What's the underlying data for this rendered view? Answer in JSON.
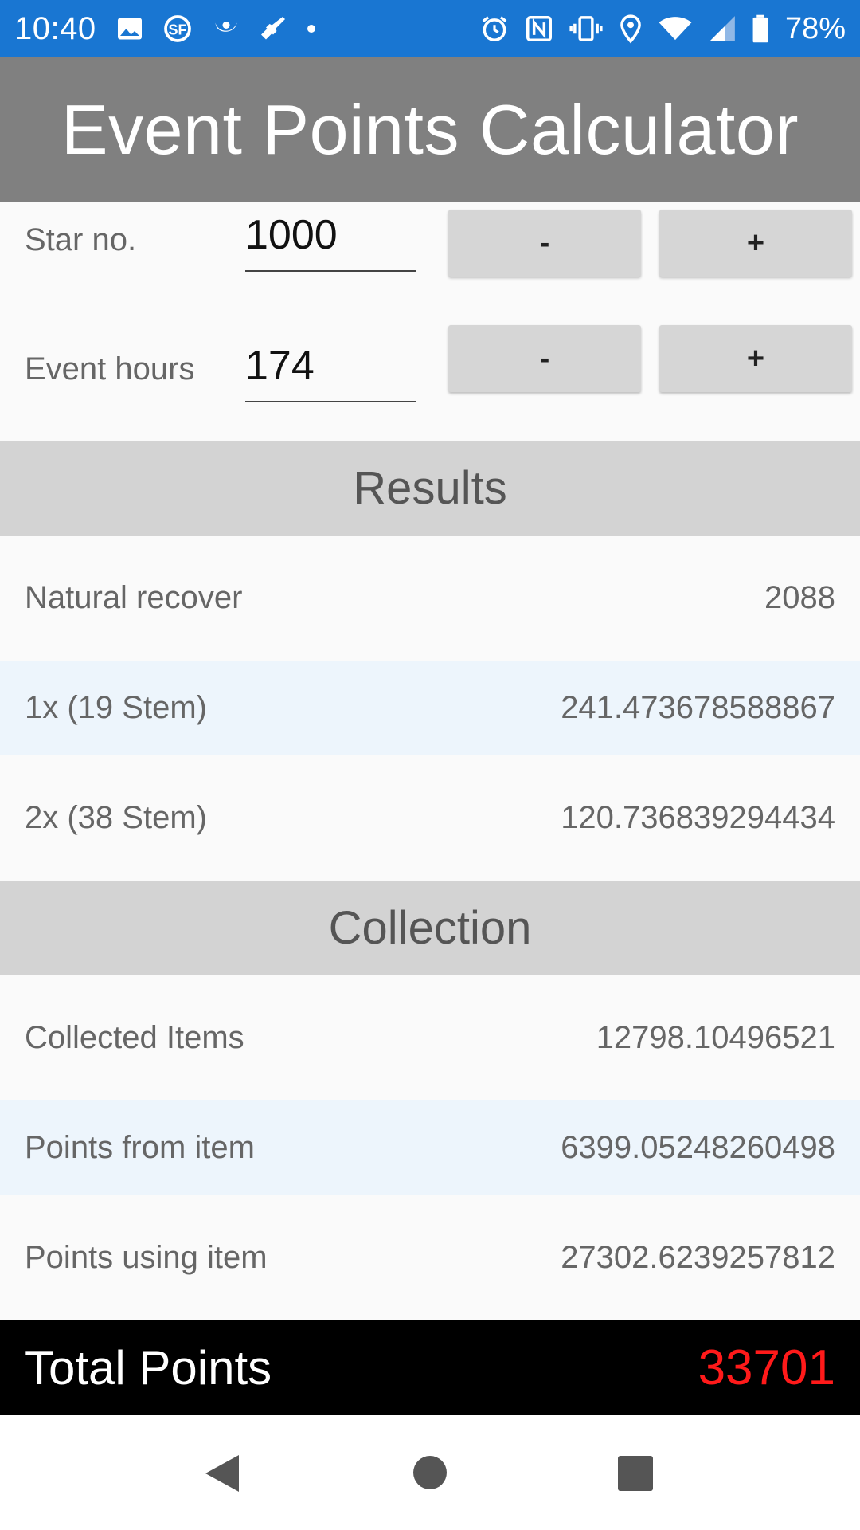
{
  "status_bar": {
    "time": "10:40",
    "battery": "78%",
    "left_icons": [
      "image-icon",
      "sf-app-icon",
      "moon-app-icon",
      "guitar-icon",
      "dot-icon"
    ],
    "right_icons": [
      "alarm-icon",
      "nfc-icon",
      "vibrate-icon",
      "location-icon",
      "wifi-icon",
      "signal-icon",
      "battery-icon"
    ]
  },
  "app_bar": {
    "title": "Event Points Calculator"
  },
  "inputs": {
    "star": {
      "label": "Star no.",
      "value": "1000",
      "minus": "-",
      "plus": "+"
    },
    "hours": {
      "label": "Event hours",
      "value": "174",
      "minus": "-",
      "plus": "+"
    }
  },
  "results": {
    "header": "Results",
    "rows": [
      {
        "label": "Natural recover",
        "value": "2088"
      },
      {
        "label": "1x (19 Stem)",
        "value": "241.473678588867"
      },
      {
        "label": "2x (38 Stem)",
        "value": "120.736839294434"
      }
    ]
  },
  "collection": {
    "header": "Collection",
    "rows": [
      {
        "label": "Collected Items",
        "value": "12798.10496521"
      },
      {
        "label": "Points from item",
        "value": "6399.05248260498"
      },
      {
        "label": "Points using item",
        "value": "27302.6239257812"
      }
    ]
  },
  "total": {
    "label": "Total Points",
    "value": "33701"
  },
  "colors": {
    "status_bar": "#1976d2",
    "app_bar": "#808080",
    "section_header": "#d3d3d3",
    "alt_row": "#edf5fc",
    "total_value": "#ff1a1a"
  },
  "nav_bar": {
    "icons": [
      "back-icon",
      "home-icon",
      "recents-icon"
    ]
  }
}
